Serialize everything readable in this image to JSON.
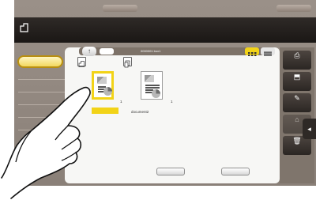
{
  "top_tabs": {
    "left_label": "",
    "right_label": ""
  },
  "header": {
    "line1": "",
    "line2": "",
    "right_text": ""
  },
  "left_panel": {
    "selected_box": ""
  },
  "path_bar": {
    "text": "0000001  box1"
  },
  "documents": [
    {
      "label": "",
      "page_count": "1",
      "selected": true
    },
    {
      "label": "document2",
      "page_count": "1",
      "selected": false
    }
  ],
  "bottom_buttons": [
    {
      "label": ""
    },
    {
      "label": ""
    }
  ],
  "right_panel": {
    "buttons": [
      {
        "icon": "print-icon",
        "glyph": "⎙",
        "label": ""
      },
      {
        "icon": "send-icon",
        "glyph": "⬒",
        "label": ""
      },
      {
        "icon": "edit-icon",
        "glyph": "✎",
        "label": ""
      },
      {
        "icon": "lock-icon",
        "glyph": "⌂",
        "label": ""
      },
      {
        "icon": "delete-icon",
        "glyph": "🗑",
        "label": ""
      }
    ]
  },
  "colors": {
    "selection": "#f2d317",
    "header": "#1f1b19",
    "frame": "#8f857d"
  }
}
